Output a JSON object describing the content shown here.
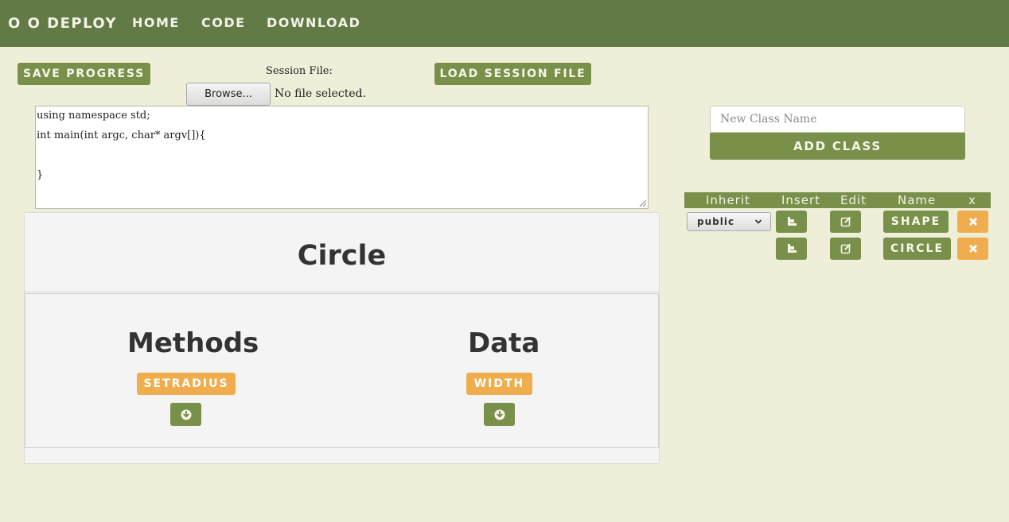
{
  "nav": {
    "brand": "O O DEPLOY",
    "links": [
      "HOME",
      "CODE",
      "DOWNLOAD"
    ]
  },
  "toolbar": {
    "save_label": "SAVE PROGRESS",
    "session_label": "Session File:",
    "browse_label": "Browse...",
    "file_status": "No file selected.",
    "load_label": "LOAD SESSION FILE"
  },
  "code": {
    "lines": [
      "using namespace std;",
      "int main(int argc, char* argv[]){",
      "",
      "}"
    ]
  },
  "class_panel": {
    "title": "Circle",
    "methods_heading": "Methods",
    "data_heading": "Data",
    "methods": [
      "SETRADIUS"
    ],
    "data": [
      "WIDTH"
    ]
  },
  "sidebar": {
    "new_class_placeholder": "New Class Name",
    "add_class_label": "ADD CLASS",
    "columns": [
      "Inherit",
      "Insert",
      "Edit",
      "Name",
      "x"
    ],
    "classes": [
      {
        "inherit": "public",
        "name": "SHAPE"
      },
      {
        "inherit": "",
        "name": "CIRCLE"
      }
    ]
  },
  "colors": {
    "nav_bg": "#627a46",
    "accent_green": "#79904a",
    "accent_orange": "#f0ad4e",
    "page_bg": "#efefd9"
  },
  "icons": {
    "insert": "indent-icon",
    "edit": "edit-icon",
    "delete": "close-icon",
    "add_member": "arrow-down-circle-icon",
    "select": "chevron-down-icon"
  }
}
